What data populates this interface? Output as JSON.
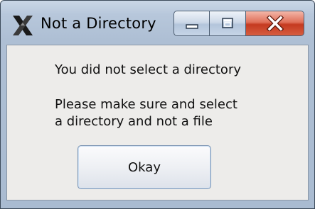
{
  "window": {
    "title": "Not a Directory",
    "icon": "x-app-icon",
    "controls": {
      "minimize_icon": "minimize-icon",
      "maximize_icon": "maximize-icon",
      "close_icon": "close-icon",
      "close_glyph": "x"
    }
  },
  "dialog": {
    "message_line1": "You did not select a directory",
    "message_line2": "Please make sure and select",
    "message_line3": "a directory and not a file",
    "okay_label": "Okay"
  },
  "colors": {
    "frame": "#b7c7db",
    "close_button": "#c53a20",
    "client_background": "#edecea"
  }
}
